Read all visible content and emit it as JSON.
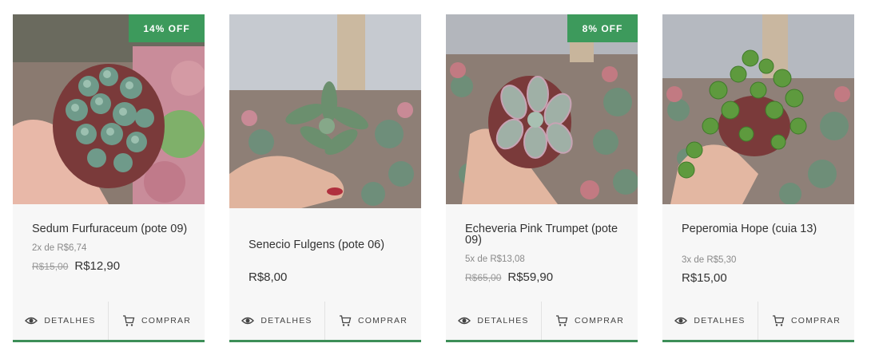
{
  "colors": {
    "accent": "#3d8f58",
    "badge": "#3d9a5c",
    "card_bg": "#f7f7f7",
    "text": "#333333",
    "muted": "#8a8a8a"
  },
  "products": [
    {
      "name": "Sedum Furfuraceum (pote 09)",
      "discount_badge": "14% OFF",
      "installments": "2x de R$6,74",
      "old_price": "R$15,00",
      "price": "R$12,90",
      "image_subject": "sedum-furfuraceum-in-pot",
      "details_label": "DETALHES",
      "buy_label": "COMPRAR"
    },
    {
      "name": "Senecio Fulgens (pote 06)",
      "discount_badge": "",
      "installments": "",
      "old_price": "",
      "price": "R$8,00",
      "image_subject": "senecio-fulgens-in-hand",
      "details_label": "DETALHES",
      "buy_label": "COMPRAR"
    },
    {
      "name": "Echeveria Pink Trumpet (pote 09)",
      "discount_badge": "8% OFF",
      "installments": "5x de R$13,08",
      "old_price": "R$65,00",
      "price": "R$59,90",
      "image_subject": "echeveria-pink-trumpet-in-pot",
      "details_label": "DETALHES",
      "buy_label": "COMPRAR"
    },
    {
      "name": "Peperomia Hope (cuia 13)",
      "discount_badge": "",
      "installments": "3x de R$5,30",
      "old_price": "",
      "price": "R$15,00",
      "image_subject": "peperomia-hope-in-pot",
      "details_label": "DETALHES",
      "buy_label": "COMPRAR"
    }
  ]
}
